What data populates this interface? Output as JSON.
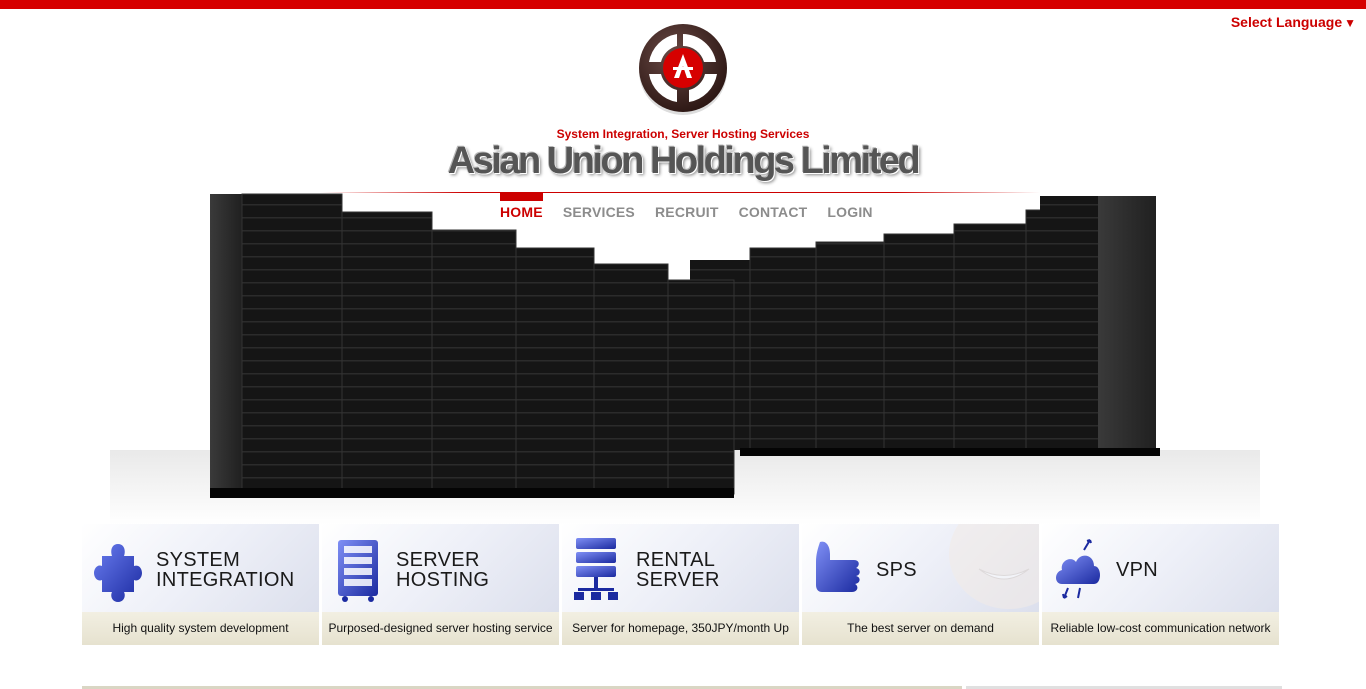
{
  "header": {
    "language_label": "Select Language",
    "language_arrow": "▼",
    "tagline": "System Integration, Server Hosting Services",
    "company_name": "Asian Union Holdings Limited"
  },
  "colors": {
    "accent": "#cc0000",
    "nav_inactive": "#8c8c8c",
    "card_caption_bg": "#ece8d6"
  },
  "nav": [
    {
      "label": "HOME",
      "active": true
    },
    {
      "label": "SERVICES",
      "active": false
    },
    {
      "label": "RECRUIT",
      "active": false
    },
    {
      "label": "CONTACT",
      "active": false
    },
    {
      "label": "LOGIN",
      "active": false
    }
  ],
  "services": [
    {
      "title": "SYSTEM\nINTEGRATION",
      "description": "High quality system development",
      "icon": "puzzle-icon"
    },
    {
      "title": "SERVER\nHOSTING",
      "description": "Purposed-designed server hosting service",
      "icon": "server-rack-icon"
    },
    {
      "title": "RENTAL\nSERVER",
      "description": "Server for homepage, 350JPY/month Up",
      "icon": "network-server-icon"
    },
    {
      "title": "SPS",
      "description": "The best server on demand",
      "icon": "thumbs-up-icon"
    },
    {
      "title": "VPN",
      "description": "Reliable low-cost communication network",
      "icon": "cloud-network-icon"
    }
  ]
}
